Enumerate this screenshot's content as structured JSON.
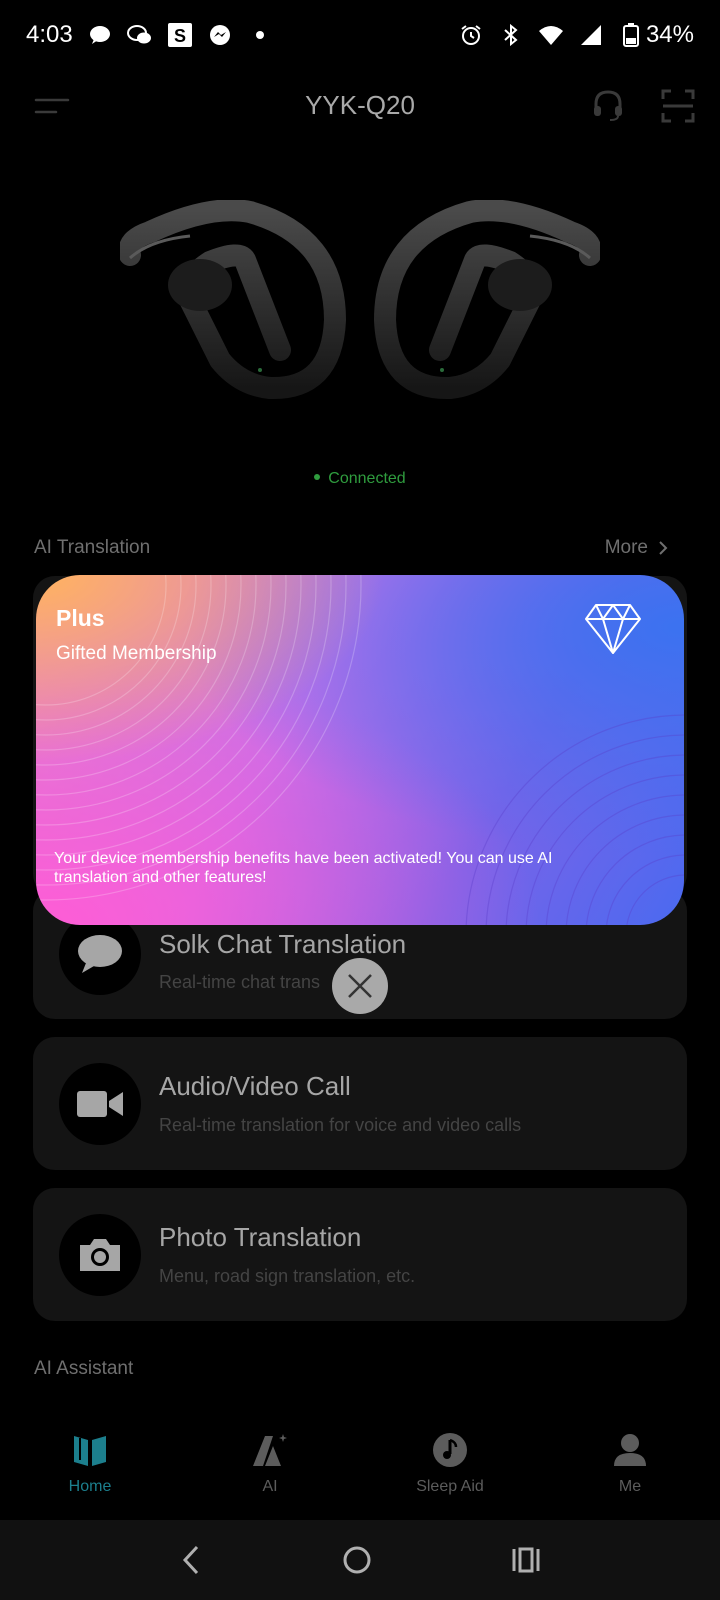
{
  "status_bar": {
    "time": "4:03",
    "battery": "34%"
  },
  "header": {
    "title": "YYK-Q20"
  },
  "device": {
    "status": "Connected"
  },
  "sections": {
    "translation_title": "AI Translation",
    "more_label": "More",
    "assistant_title": "AI Assistant"
  },
  "cards": [
    {
      "title": "Solk Chat Translation",
      "subtitle": "Real-time chat trans",
      "icon": "chat-bubble-icon"
    },
    {
      "title": "Audio/Video Call",
      "subtitle": "Real-time translation for voice and video calls",
      "icon": "video-camera-icon"
    },
    {
      "title": "Photo Translation",
      "subtitle": "Menu, road sign translation, etc.",
      "icon": "camera-icon"
    }
  ],
  "popup": {
    "title": "Plus",
    "subtitle": "Gifted Membership",
    "message": "Your device membership benefits have been activated! You can use AI translation and other features!"
  },
  "bottom_nav": [
    {
      "label": "Home",
      "icon": "book-icon",
      "active": true
    },
    {
      "label": "AI",
      "icon": "ai-icon",
      "active": false
    },
    {
      "label": "Sleep Aid",
      "icon": "music-note-icon",
      "active": false
    },
    {
      "label": "Me",
      "icon": "person-icon",
      "active": false
    }
  ],
  "colors": {
    "accent": "#1c7f8d",
    "connected": "#2f9c3e",
    "card_bg": "#141414"
  }
}
